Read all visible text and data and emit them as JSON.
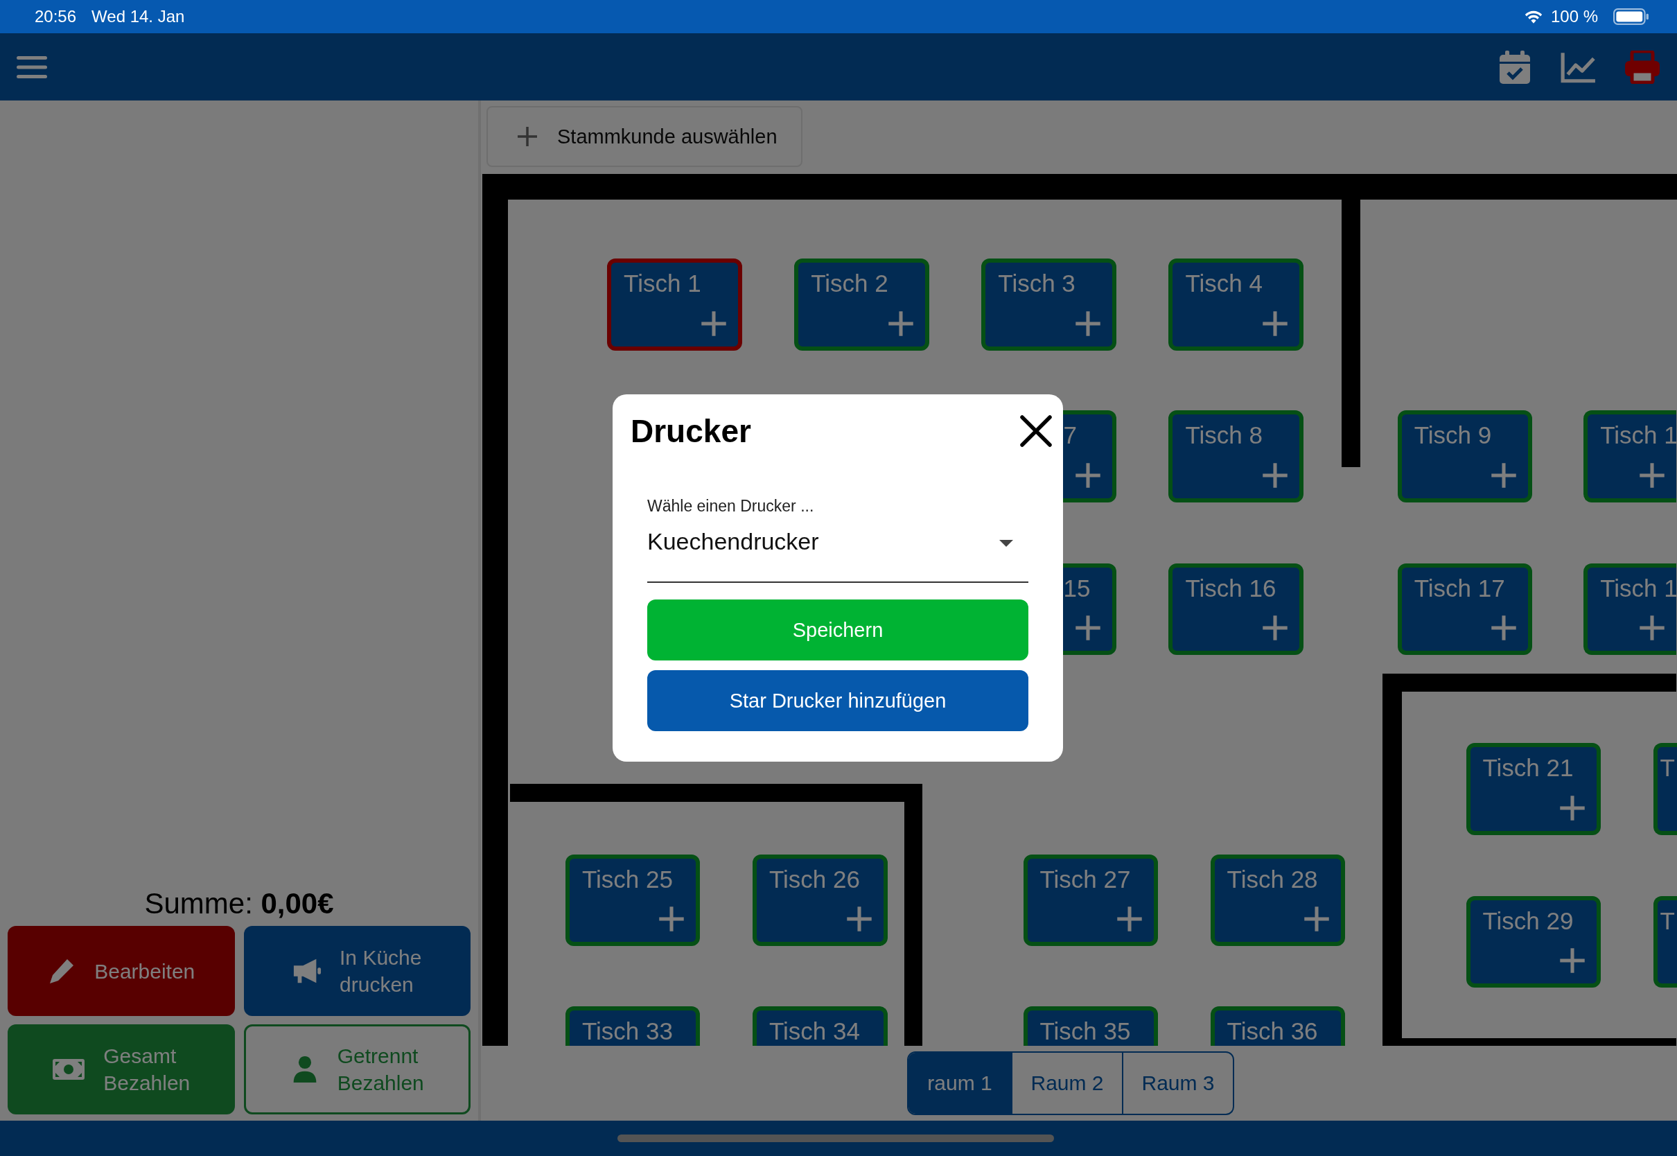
{
  "status_bar": {
    "time": "20:56",
    "date": "Wed 14. Jan",
    "battery": "100 %"
  },
  "customer_button": {
    "label": "Stammkunde auswählen"
  },
  "order_panel": {
    "total_label": "Summe:",
    "total": "0,00€",
    "buttons": [
      {
        "label": "Bearbeiten",
        "kind": "edit"
      },
      {
        "label": "Gesamt\nBezahlen",
        "kind": "pay"
      },
      {
        "label": "In Küche\ndrucken",
        "kind": "kitchen"
      },
      {
        "label": "Getrennt\nBezahlen",
        "kind": "split"
      }
    ]
  },
  "floor_plan": {
    "tables": [
      {
        "label": "Tisch 1",
        "selected": true
      },
      {
        "label": "Tisch 2",
        "selected": false
      },
      {
        "label": "Tisch 3",
        "selected": false
      },
      {
        "label": "Tisch 4",
        "selected": false
      },
      {
        "label": "7",
        "selected": false
      },
      {
        "label": "Tisch 8",
        "selected": false
      },
      {
        "label": "Tisch 9",
        "selected": false
      },
      {
        "label": "Tisch 1",
        "selected": false
      },
      {
        "label": "15",
        "selected": false
      },
      {
        "label": "Tisch 16",
        "selected": false
      },
      {
        "label": "Tisch 17",
        "selected": false
      },
      {
        "label": "Tisch 1",
        "selected": false
      },
      {
        "label": "Tisch 21",
        "selected": false
      },
      {
        "label": "T",
        "selected": false
      },
      {
        "label": "Tisch 25",
        "selected": false
      },
      {
        "label": "Tisch 26",
        "selected": false
      },
      {
        "label": "Tisch 27",
        "selected": false
      },
      {
        "label": "Tisch 28",
        "selected": false
      },
      {
        "label": "Tisch 29",
        "selected": false
      },
      {
        "label": "T",
        "selected": false
      },
      {
        "label": "Tisch 33",
        "selected": false
      },
      {
        "label": "Tisch 34",
        "selected": false
      },
      {
        "label": "Tisch 35",
        "selected": false
      },
      {
        "label": "Tisch 36",
        "selected": false
      }
    ]
  },
  "room_tabs": [
    {
      "label": "raum 1",
      "selected": true
    },
    {
      "label": "Raum 2",
      "selected": false
    },
    {
      "label": "Raum 3",
      "selected": false
    }
  ],
  "dialog": {
    "title": "Drucker",
    "field_label": "Wähle einen Drucker ...",
    "value": "Kuechendrucker",
    "buttons": [
      {
        "label": "Speichern",
        "kind": "primary"
      },
      {
        "label": "Star Drucker hinzufügen",
        "kind": "secondary"
      }
    ]
  }
}
